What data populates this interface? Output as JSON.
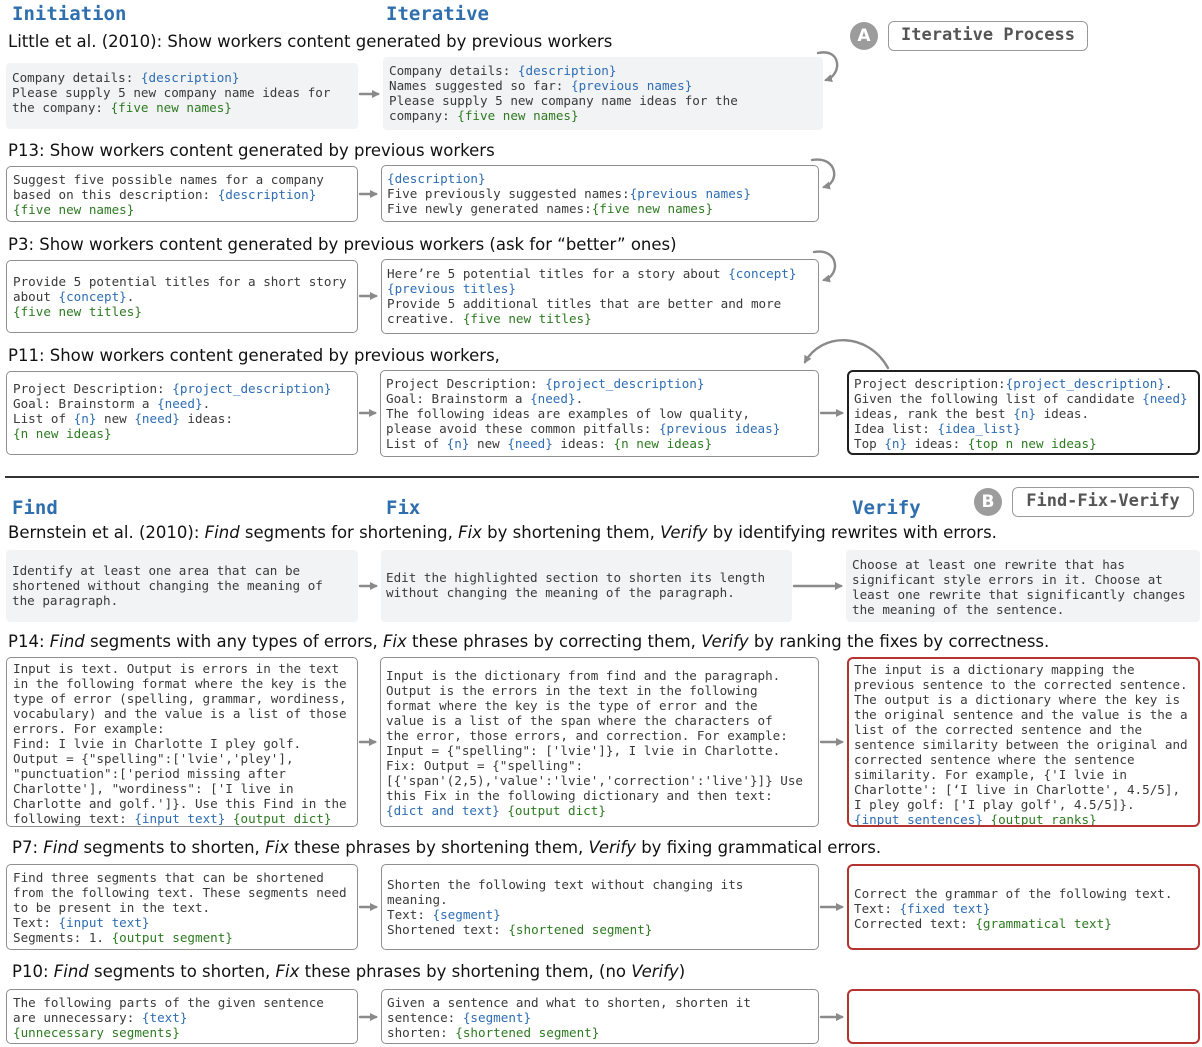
{
  "section_a": {
    "badge": "A",
    "label": "Iterative Process",
    "col_initiation": "Initiation",
    "col_iterative": "Iterative",
    "rows": [
      {
        "title": [
          {
            "t": "Little et al. (2010): Show workers content generated by previous workers"
          }
        ],
        "boxes": [
          [
            [
              {
                "t": "Company details: "
              },
              {
                "t": "{description}",
                "c": "v"
              }
            ],
            [
              {
                "t": "Please supply 5 new company name ideas for"
              }
            ],
            [
              {
                "t": "the company: "
              },
              {
                "t": "{five new names}",
                "c": "g"
              }
            ]
          ],
          [
            [
              {
                "t": "Company details: "
              },
              {
                "t": "{description}",
                "c": "v"
              }
            ],
            [
              {
                "t": "Names suggested so far: "
              },
              {
                "t": "{previous names}",
                "c": "v"
              }
            ],
            [
              {
                "t": "Please supply 5 new company name ideas for the"
              }
            ],
            [
              {
                "t": "company: "
              },
              {
                "t": "{five new names}",
                "c": "g"
              }
            ]
          ]
        ]
      },
      {
        "title": [
          {
            "t": "P13: Show workers content generated by previous workers"
          }
        ],
        "boxes": [
          [
            [
              {
                "t": "Suggest five possible names for a company"
              }
            ],
            [
              {
                "t": "based on this description: "
              },
              {
                "t": "{description}",
                "c": "v"
              }
            ],
            [
              {
                "t": "{five new names}",
                "c": "g"
              }
            ]
          ],
          [
            [
              {
                "t": "{description}",
                "c": "v"
              }
            ],
            [
              {
                "t": "Five previously suggested names:"
              },
              {
                "t": "{previous names}",
                "c": "v"
              }
            ],
            [
              {
                "t": "Five newly generated names:"
              },
              {
                "t": "{five new names}",
                "c": "g"
              }
            ]
          ]
        ]
      },
      {
        "title": [
          {
            "t": "P3: Show workers content generated by previous workers (ask for “better” ones)"
          }
        ],
        "boxes": [
          [
            [
              {
                "t": "Provide 5 potential titles for a short story"
              }
            ],
            [
              {
                "t": "about "
              },
              {
                "t": "{concept}",
                "c": "v"
              },
              {
                "t": "."
              }
            ],
            [
              {
                "t": "{five new titles}",
                "c": "g"
              }
            ]
          ],
          [
            [
              {
                "t": "Here’re 5 potential titles for a story about "
              },
              {
                "t": "{concept}",
                "c": "v"
              }
            ],
            [
              {
                "t": "{previous titles}",
                "c": "v"
              }
            ],
            [
              {
                "t": "Provide 5 additional titles that are better and more"
              }
            ],
            [
              {
                "t": "creative. "
              },
              {
                "t": "{five new titles}",
                "c": "g"
              }
            ]
          ]
        ]
      },
      {
        "title": [
          {
            "t": "P11: Show workers content generated by previous workers,"
          }
        ],
        "boxes": [
          [
            [
              {
                "t": "Project Description: "
              },
              {
                "t": "{project_description}",
                "c": "v"
              }
            ],
            [
              {
                "t": "Goal: Brainstorm a "
              },
              {
                "t": "{need}",
                "c": "v"
              },
              {
                "t": "."
              }
            ],
            [
              {
                "t": "List of "
              },
              {
                "t": "{n}",
                "c": "v"
              },
              {
                "t": " new "
              },
              {
                "t": "{need}",
                "c": "v"
              },
              {
                "t": " ideas:"
              }
            ],
            [
              {
                "t": "{n new ideas}",
                "c": "g"
              }
            ]
          ],
          [
            [
              {
                "t": "Project Description: "
              },
              {
                "t": "{project_description}",
                "c": "v"
              }
            ],
            [
              {
                "t": "Goal: Brainstorm a "
              },
              {
                "t": "{need}",
                "c": "v"
              },
              {
                "t": "."
              }
            ],
            [
              {
                "t": "The following ideas are examples of low quality,"
              }
            ],
            [
              {
                "t": "please avoid these common pitfalls: "
              },
              {
                "t": "{previous ideas}",
                "c": "v"
              }
            ],
            [
              {
                "t": "List of "
              },
              {
                "t": "{n}",
                "c": "v"
              },
              {
                "t": " new "
              },
              {
                "t": "{need}",
                "c": "v"
              },
              {
                "t": " ideas: "
              },
              {
                "t": "{n new ideas}",
                "c": "g"
              }
            ]
          ],
          [
            [
              {
                "t": "Project description:"
              },
              {
                "t": "{project_description}",
                "c": "v"
              },
              {
                "t": "."
              }
            ],
            [
              {
                "t": "Given the following list of candidate "
              },
              {
                "t": "{need}",
                "c": "v"
              }
            ],
            [
              {
                "t": "ideas, rank the best "
              },
              {
                "t": "{n}",
                "c": "v"
              },
              {
                "t": " ideas."
              }
            ],
            [
              {
                "t": "Idea list: "
              },
              {
                "t": "{idea_list}",
                "c": "v"
              }
            ],
            [
              {
                "t": "Top "
              },
              {
                "t": "{n}",
                "c": "v"
              },
              {
                "t": " ideas: "
              },
              {
                "t": "{top n new ideas}",
                "c": "g"
              }
            ]
          ]
        ]
      }
    ]
  },
  "section_b": {
    "badge": "B",
    "label": "Find-Fix-Verify",
    "col_find": "Find",
    "col_fix": "Fix",
    "col_verify": "Verify",
    "rows": [
      {
        "title": [
          {
            "t": "Bernstein et al. (2010): "
          },
          {
            "t": "Find",
            "i": true
          },
          {
            "t": " segments for shortening, "
          },
          {
            "t": "Fix",
            "i": true
          },
          {
            "t": " by shortening them, "
          },
          {
            "t": "Verify",
            "i": true
          },
          {
            "t": " by identifying rewrites with errors."
          }
        ],
        "boxes": [
          [
            [
              {
                "t": "Identify at least one area that can be"
              }
            ],
            [
              {
                "t": "shortened without changing the meaning of"
              }
            ],
            [
              {
                "t": "the paragraph."
              }
            ]
          ],
          [
            [
              {
                "t": "Edit the highlighted section to shorten its length"
              }
            ],
            [
              {
                "t": "without changing the meaning of the paragraph."
              }
            ]
          ],
          [
            [
              {
                "t": "Choose at least one rewrite that has"
              }
            ],
            [
              {
                "t": "significant style errors in it. Choose at"
              }
            ],
            [
              {
                "t": "least one rewrite that significantly changes"
              }
            ],
            [
              {
                "t": "the meaning of the sentence."
              }
            ]
          ]
        ]
      },
      {
        "title": [
          {
            "t": "P14: "
          },
          {
            "t": "Find",
            "i": true
          },
          {
            "t": " segments with any types of errors, "
          },
          {
            "t": "Fix",
            "i": true
          },
          {
            "t": " these phrases by correcting them, "
          },
          {
            "t": "Verify",
            "i": true
          },
          {
            "t": " by ranking the fixes by correctness."
          }
        ],
        "boxes": [
          [
            [
              {
                "t": "Input is text. Output is errors in the text"
              }
            ],
            [
              {
                "t": "in the following format where the key is the"
              }
            ],
            [
              {
                "t": "type of error (spelling, grammar, wordiness,"
              }
            ],
            [
              {
                "t": "vocabulary) and the value is a list of those"
              }
            ],
            [
              {
                "t": "errors. For example:"
              }
            ],
            [
              {
                "t": "Find: I lvie in Charlotte I pley golf."
              }
            ],
            [
              {
                "t": "Output = {\"spelling\":['lvie','pley'],"
              }
            ],
            [
              {
                "t": "\"punctuation\":['period missing after"
              }
            ],
            [
              {
                "t": "Charlotte'], \"wordiness\": ['I live in"
              }
            ],
            [
              {
                "t": "Charlotte and golf.']}. Use this Find in the"
              }
            ],
            [
              {
                "t": "following text: "
              },
              {
                "t": "{input text}",
                "c": "v"
              },
              {
                "t": " "
              },
              {
                "t": "{output dict}",
                "c": "g"
              }
            ]
          ],
          [
            [
              {
                "t": "Input is the dictionary from find and the paragraph."
              }
            ],
            [
              {
                "t": "Output is the errors in the text in the following"
              }
            ],
            [
              {
                "t": "format where the key is the type of error and the"
              }
            ],
            [
              {
                "t": "value is a list of the span where the characters of"
              }
            ],
            [
              {
                "t": "the error, those errors, and correction. For example:"
              }
            ],
            [
              {
                "t": "Input = {\"spelling\": ['lvie']}, I lvie in Charlotte."
              }
            ],
            [
              {
                "t": "Fix: Output = {\"spelling\":"
              }
            ],
            [
              {
                "t": "[{'span'(2,5),'value':'lvie','correction':'live'}]} Use"
              }
            ],
            [
              {
                "t": "this Fix in the following dictionary and then text:"
              }
            ],
            [
              {
                "t": "{dict and text}",
                "c": "v"
              },
              {
                "t": " "
              },
              {
                "t": "{output dict}",
                "c": "g"
              }
            ]
          ],
          [
            [
              {
                "t": "The input is a dictionary mapping the"
              }
            ],
            [
              {
                "t": "previous sentence to the corrected sentence."
              }
            ],
            [
              {
                "t": "The output is a dictionary where the key is"
              }
            ],
            [
              {
                "t": "the original sentence and the value is the a"
              }
            ],
            [
              {
                "t": "list of the corrected sentence and the"
              }
            ],
            [
              {
                "t": "sentence similarity between the original and"
              }
            ],
            [
              {
                "t": "corrected sentence where the sentence"
              }
            ],
            [
              {
                "t": "similarity. For example, {'I lvie in"
              }
            ],
            [
              {
                "t": "Charlotte': [‘I live in Charlotte', 4.5/5],"
              }
            ],
            [
              {
                "t": "I pley golf: ['I play golf', 4.5/5]}."
              }
            ],
            [
              {
                "t": "{input sentences}",
                "c": "v"
              },
              {
                "t": " "
              },
              {
                "t": "{output ranks}",
                "c": "g"
              }
            ]
          ]
        ]
      },
      {
        "title": [
          {
            "t": "P7: "
          },
          {
            "t": "Find",
            "i": true
          },
          {
            "t": " segments to shorten, "
          },
          {
            "t": "Fix",
            "i": true
          },
          {
            "t": " these phrases by shortening them, "
          },
          {
            "t": "Verify",
            "i": true
          },
          {
            "t": " by fixing grammatical errors."
          }
        ],
        "boxes": [
          [
            [
              {
                "t": "Find three segments that can be shortened"
              }
            ],
            [
              {
                "t": "from the following text. These segments need"
              }
            ],
            [
              {
                "t": "to be present in the text."
              }
            ],
            [
              {
                "t": "Text: "
              },
              {
                "t": "{input text}",
                "c": "v"
              }
            ],
            [
              {
                "t": "Segments: 1. "
              },
              {
                "t": "{output segment}",
                "c": "g"
              }
            ]
          ],
          [
            [
              {
                "t": "Shorten the following text without changing its"
              }
            ],
            [
              {
                "t": "meaning."
              }
            ],
            [
              {
                "t": "Text: "
              },
              {
                "t": "{segment}",
                "c": "v"
              }
            ],
            [
              {
                "t": "Shortened text: "
              },
              {
                "t": "{shortened segment}",
                "c": "g"
              }
            ]
          ],
          [
            [
              {
                "t": "Correct the grammar of the following text."
              }
            ],
            [
              {
                "t": "Text: "
              },
              {
                "t": "{fixed text}",
                "c": "v"
              }
            ],
            [
              {
                "t": "Corrected text: "
              },
              {
                "t": "{grammatical text}",
                "c": "g"
              }
            ]
          ]
        ]
      },
      {
        "title": [
          {
            "t": "P10: "
          },
          {
            "t": "Find",
            "i": true
          },
          {
            "t": " segments to shorten, "
          },
          {
            "t": "Fix",
            "i": true
          },
          {
            "t": " these phrases by shortening them, (no "
          },
          {
            "t": "Verify",
            "i": true
          },
          {
            "t": ")"
          }
        ],
        "boxes": [
          [
            [
              {
                "t": "The following parts of the given sentence"
              }
            ],
            [
              {
                "t": "are unnecessary: "
              },
              {
                "t": "{text}",
                "c": "v"
              }
            ],
            [
              {
                "t": "{unnecessary segments}",
                "c": "g"
              }
            ]
          ],
          [
            [
              {
                "t": "Given a sentence and what to shorten, shorten it"
              }
            ],
            [
              {
                "t": "sentence: "
              },
              {
                "t": "{segment}",
                "c": "v"
              }
            ],
            [
              {
                "t": "shorten: "
              },
              {
                "t": "{shortened segment}",
                "c": "g"
              }
            ]
          ],
          []
        ]
      }
    ]
  }
}
